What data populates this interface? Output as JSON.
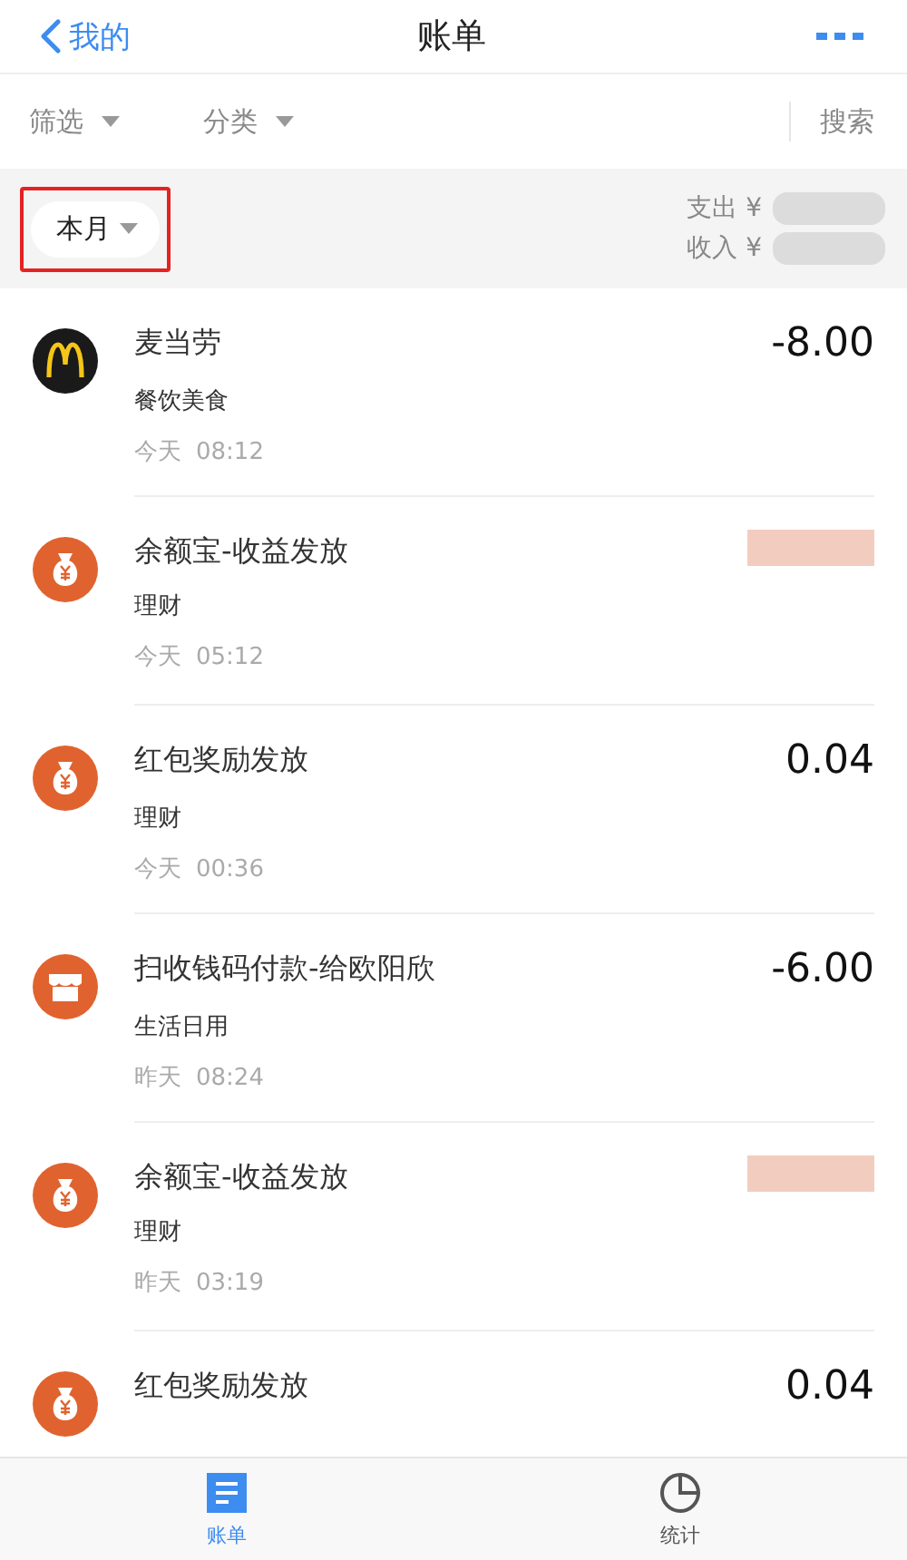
{
  "nav": {
    "back": "我的",
    "title": "账单"
  },
  "filters": {
    "items": [
      "筛选",
      "分类"
    ],
    "search": "搜索"
  },
  "summary": {
    "period": {
      "label": "本月",
      "highlighted": true
    },
    "expense_label": "支出 ¥",
    "income_label": "收入 ¥"
  },
  "bills": [
    {
      "kind": "arches",
      "title": "麦当劳",
      "category": "餐饮美食",
      "day": "今天",
      "time": "08:12",
      "amount": "-8.00"
    },
    {
      "kind": "money-bag",
      "title": "余额宝-收益发放",
      "category": "理财",
      "day": "今天",
      "time": "05:12"
    },
    {
      "kind": "money-bag",
      "title": "红包奖励发放",
      "category": "理财",
      "day": "今天",
      "time": "00:36",
      "amount": "0.04"
    },
    {
      "kind": "shop",
      "title": "扫收钱码付款-给欧阳欣",
      "category": "生活日用",
      "day": "昨天",
      "time": "08:24",
      "amount": "-6.00"
    },
    {
      "kind": "money-bag",
      "title": "余额宝-收益发放",
      "category": "理财",
      "day": "昨天",
      "time": "03:19"
    },
    {
      "kind": "money-bag",
      "title": "红包奖励发放",
      "amount": "0.04"
    }
  ],
  "tabs": [
    {
      "label": "账单",
      "kind": "bill",
      "selected": true
    },
    {
      "label": "统计",
      "kind": "stats",
      "selected": false
    }
  ]
}
